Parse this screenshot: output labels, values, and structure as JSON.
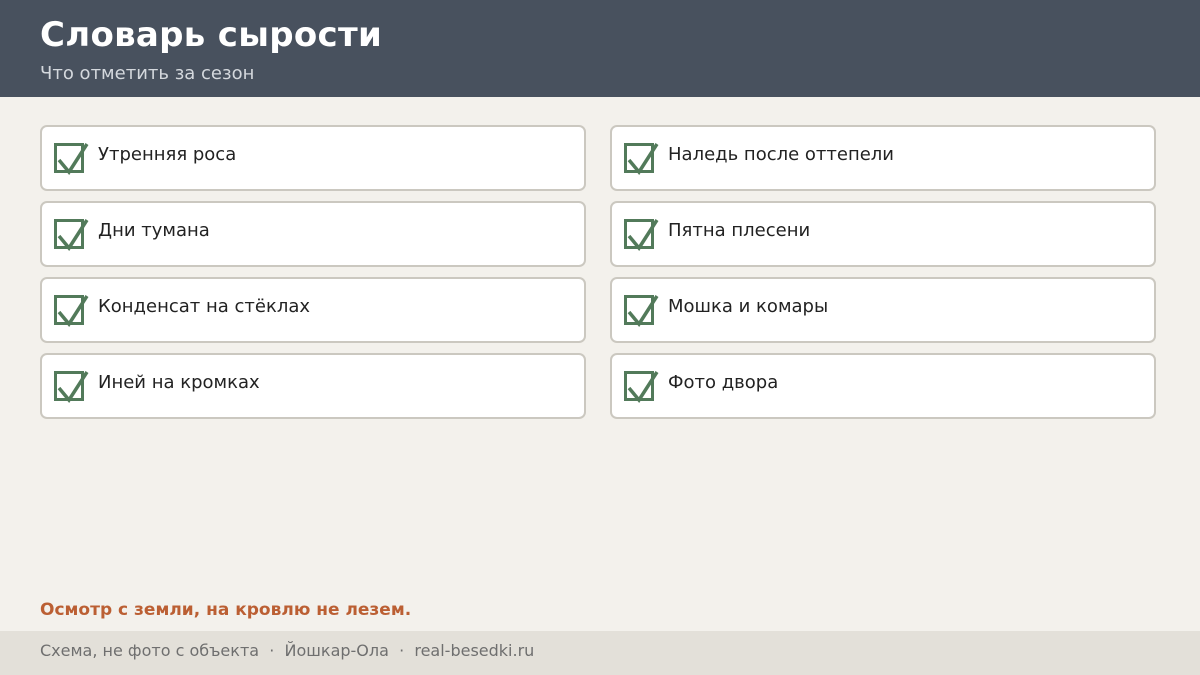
{
  "header": {
    "title": "Словарь сырости",
    "subtitle": "Что отметить за сезон"
  },
  "checklist": {
    "left": [
      {
        "label": "Утренняя роса",
        "checked": true
      },
      {
        "label": "Дни тумана",
        "checked": true
      },
      {
        "label": "Конденсат на стёклах",
        "checked": true
      },
      {
        "label": "Иней на кромках",
        "checked": true
      }
    ],
    "right": [
      {
        "label": "Наледь после оттепели",
        "checked": true
      },
      {
        "label": "Пятна плесени",
        "checked": true
      },
      {
        "label": "Мошка и комары",
        "checked": true
      },
      {
        "label": "Фото двора",
        "checked": true
      }
    ]
  },
  "warning": "Осмотр с земли, на кровлю не лезем.",
  "footer": {
    "note": "Схема, не фото с объекта",
    "city": "Йошкар-Ола",
    "site": "real-besedki.ru",
    "separator": "·"
  },
  "colors": {
    "header_bg": "#48515e",
    "check_green": "#527a5a",
    "warning_orange": "#bb5f33",
    "page_bg": "#f3f1ec",
    "footer_bg": "#e3e0d9"
  }
}
